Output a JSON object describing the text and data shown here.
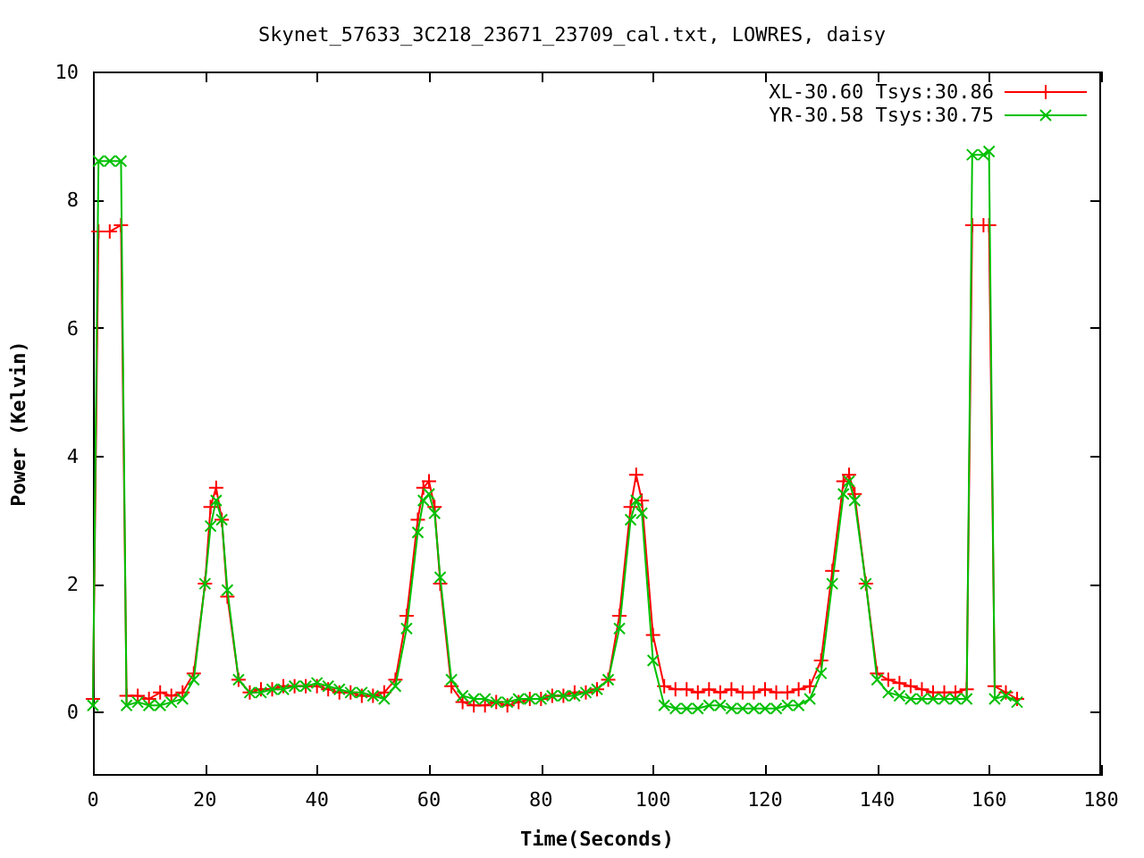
{
  "chart": {
    "chart_data": {
      "type": "line",
      "title": "Skynet_57633_3C218_23671_23709_cal.txt, LOWRES, daisy",
      "xlabel": "Time(Seconds)",
      "ylabel": "Power (Kelvin)",
      "x": [
        0,
        1,
        3,
        5,
        6,
        8,
        10,
        12,
        14,
        16,
        18,
        20,
        21,
        22,
        23,
        24,
        26,
        28,
        30,
        32,
        34,
        36,
        38,
        40,
        42,
        44,
        46,
        48,
        50,
        52,
        54,
        56,
        58,
        59,
        60,
        61,
        62,
        64,
        66,
        68,
        70,
        72,
        74,
        76,
        78,
        80,
        82,
        84,
        86,
        88,
        90,
        92,
        94,
        96,
        97,
        98,
        100,
        102,
        104,
        106,
        108,
        110,
        112,
        114,
        116,
        118,
        120,
        122,
        124,
        126,
        128,
        130,
        132,
        134,
        135,
        136,
        138,
        140,
        142,
        144,
        146,
        148,
        150,
        152,
        154,
        156,
        157,
        159,
        160,
        161,
        163,
        165
      ],
      "series": [
        {
          "name": "XL-30.60 Tsys:30.86",
          "color": "#ff0000",
          "marker": "plus",
          "values": [
            0.2,
            7.5,
            7.5,
            7.6,
            0.25,
            0.25,
            0.2,
            0.3,
            0.25,
            0.3,
            0.6,
            2.0,
            3.2,
            3.5,
            3.0,
            1.8,
            0.5,
            0.3,
            0.35,
            0.35,
            0.4,
            0.4,
            0.4,
            0.4,
            0.35,
            0.3,
            0.3,
            0.25,
            0.25,
            0.3,
            0.5,
            1.5,
            3.0,
            3.5,
            3.6,
            3.2,
            2.0,
            0.4,
            0.15,
            0.1,
            0.1,
            0.15,
            0.1,
            0.15,
            0.2,
            0.2,
            0.25,
            0.25,
            0.3,
            0.3,
            0.35,
            0.5,
            1.5,
            3.2,
            3.7,
            3.3,
            1.2,
            0.4,
            0.35,
            0.35,
            0.3,
            0.35,
            0.3,
            0.35,
            0.3,
            0.3,
            0.35,
            0.3,
            0.3,
            0.35,
            0.4,
            0.8,
            2.2,
            3.6,
            3.7,
            3.4,
            2.0,
            0.6,
            0.5,
            0.45,
            0.4,
            0.35,
            0.3,
            0.3,
            0.3,
            0.35,
            7.6,
            7.6,
            7.6,
            0.4,
            0.3,
            0.2
          ]
        },
        {
          "name": "YR-30.58 Tsys:30.75",
          "color": "#00c000",
          "marker": "cross",
          "values": [
            0.1,
            8.6,
            8.6,
            8.6,
            0.1,
            0.15,
            0.1,
            0.1,
            0.15,
            0.2,
            0.5,
            2.0,
            2.9,
            3.3,
            3.0,
            1.9,
            0.5,
            0.3,
            0.3,
            0.35,
            0.35,
            0.4,
            0.4,
            0.45,
            0.4,
            0.35,
            0.3,
            0.3,
            0.25,
            0.2,
            0.4,
            1.3,
            2.8,
            3.3,
            3.4,
            3.1,
            2.1,
            0.5,
            0.25,
            0.2,
            0.2,
            0.15,
            0.15,
            0.2,
            0.2,
            0.2,
            0.25,
            0.25,
            0.25,
            0.3,
            0.35,
            0.5,
            1.3,
            3.0,
            3.3,
            3.1,
            0.8,
            0.1,
            0.05,
            0.05,
            0.05,
            0.1,
            0.1,
            0.05,
            0.05,
            0.05,
            0.05,
            0.05,
            0.1,
            0.1,
            0.2,
            0.6,
            2.0,
            3.4,
            3.6,
            3.3,
            2.0,
            0.5,
            0.3,
            0.25,
            0.2,
            0.2,
            0.2,
            0.2,
            0.2,
            0.2,
            8.7,
            8.7,
            8.75,
            0.2,
            0.25,
            0.15
          ]
        }
      ],
      "legend": true,
      "xlim": [
        0,
        180
      ],
      "ylim": [
        -1,
        10
      ],
      "xticks": [
        0,
        20,
        40,
        60,
        80,
        100,
        120,
        140,
        160,
        180
      ],
      "yticks": [
        0,
        2,
        4,
        6,
        8,
        10
      ]
    }
  }
}
